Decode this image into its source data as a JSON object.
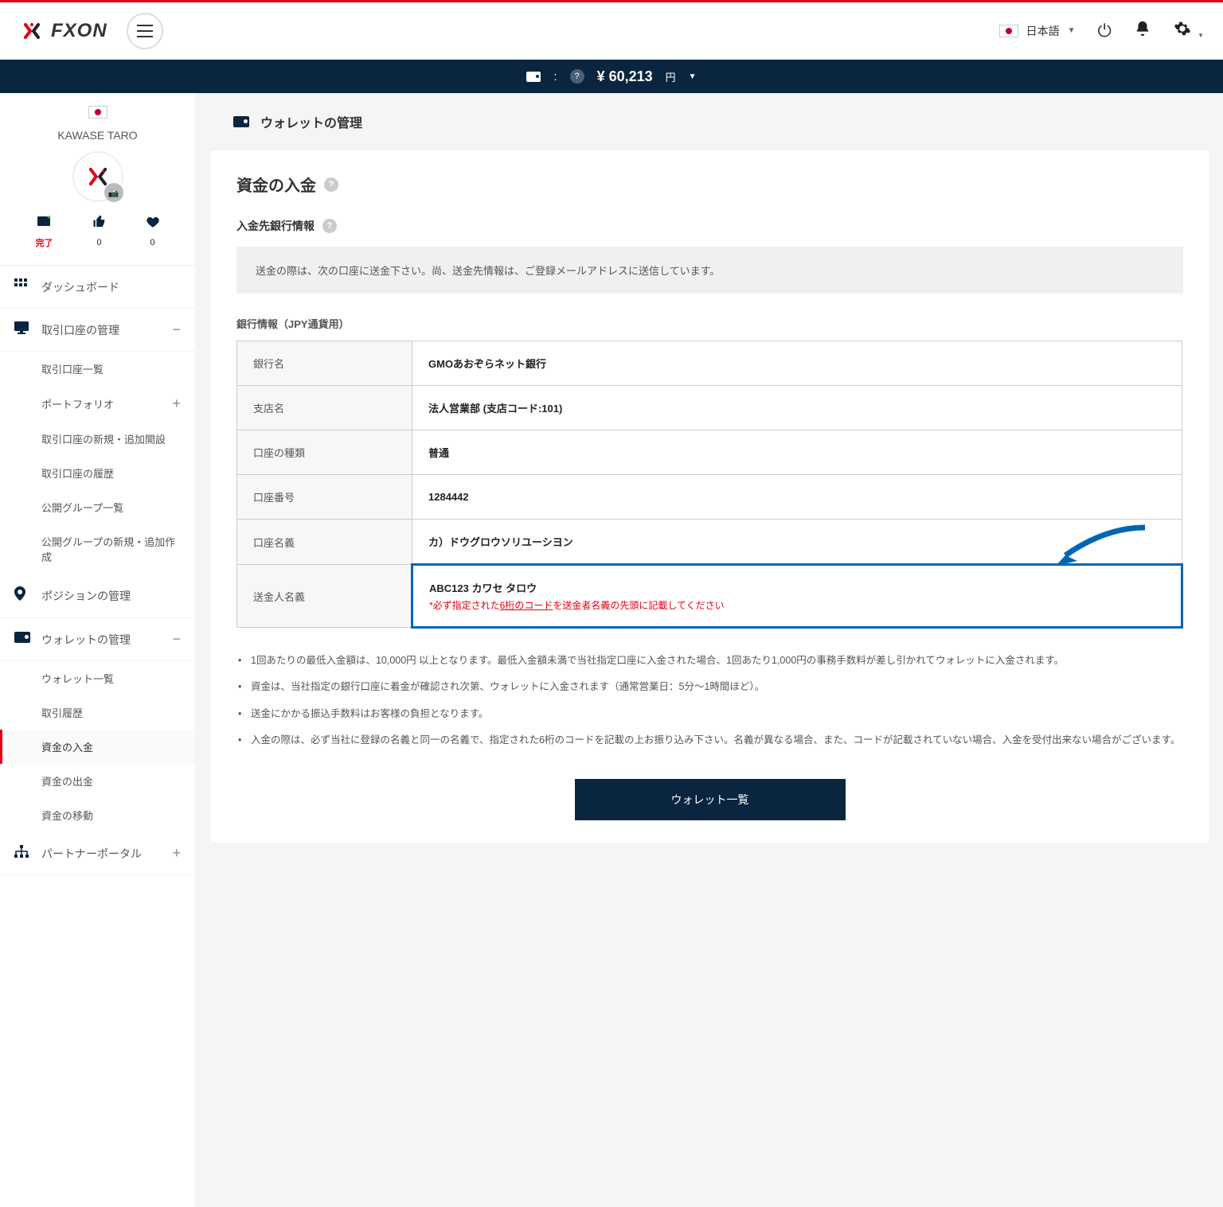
{
  "header": {
    "logo_text": "FXON",
    "lang_label": "日本語"
  },
  "balance": {
    "amount": "¥ 60,213",
    "currency": "円"
  },
  "user": {
    "name": "KAWASE TARO",
    "stat_complete": "完了",
    "stat_like": "0",
    "stat_heart": "0"
  },
  "nav": {
    "dashboard": "ダッシュボード",
    "account": "取引口座の管理",
    "account_list": "取引口座一覧",
    "portfolio": "ポートフォリオ",
    "account_new": "取引口座の新規・追加開設",
    "account_history": "取引口座の履歴",
    "public_groups": "公開グループ一覧",
    "public_groups_new": "公開グループの新規・追加作成",
    "position": "ポジションの管理",
    "wallet": "ウォレットの管理",
    "wallet_list": "ウォレット一覧",
    "trade_history": "取引履歴",
    "deposit": "資金の入金",
    "withdraw": "資金の出金",
    "transfer": "資金の移動",
    "partner": "パートナーポータル"
  },
  "page": {
    "breadcrumb": "ウォレットの管理",
    "title": "資金の入金",
    "sub_title": "入金先銀行情報",
    "info_note": "送金の際は、次の口座に送金下さい。尚、送金先情報は、ご登録メールアドレスに送信しています。",
    "table_caption": "銀行情報（JPY通貨用）"
  },
  "bank": {
    "labels": {
      "name": "銀行名",
      "branch": "支店名",
      "type": "口座の種類",
      "number": "口座番号",
      "holder": "口座名義",
      "sender": "送金人名義"
    },
    "values": {
      "name": "GMOあおぞらネット銀行",
      "branch": "法人営業部 (支店コード:101)",
      "type": "普通",
      "number": "1284442",
      "holder": "カ）ドウグロウソリユーシヨン",
      "sender_code": "ABC123 カワセ タロウ",
      "sender_note_pre": "*必ず指定された",
      "sender_note_u": "6桁のコード",
      "sender_note_post": "を送金者名義の先頭に記載してください"
    }
  },
  "notes": {
    "n1": "1回あたりの最低入金額は、10,000円 以上となります。最低入金額未満で当社指定口座に入金された場合、1回あたり1,000円の事務手数料が差し引かれてウォレットに入金されます。",
    "n2": "資金は、当社指定の銀行口座に着金が確認され次第、ウォレットに入金されます（通常営業日：5分～1時間ほど）。",
    "n3": "送金にかかる振込手数料はお客様の負担となります。",
    "n4": "入金の際は、必ず当社に登録の名義と同一の名義で、指定された6桁のコードを記載の上お振り込み下さい。名義が異なる場合、また、コードが記載されていない場合、入金を受付出来ない場合がございます。"
  },
  "buttons": {
    "wallet_list": "ウォレット一覧"
  }
}
